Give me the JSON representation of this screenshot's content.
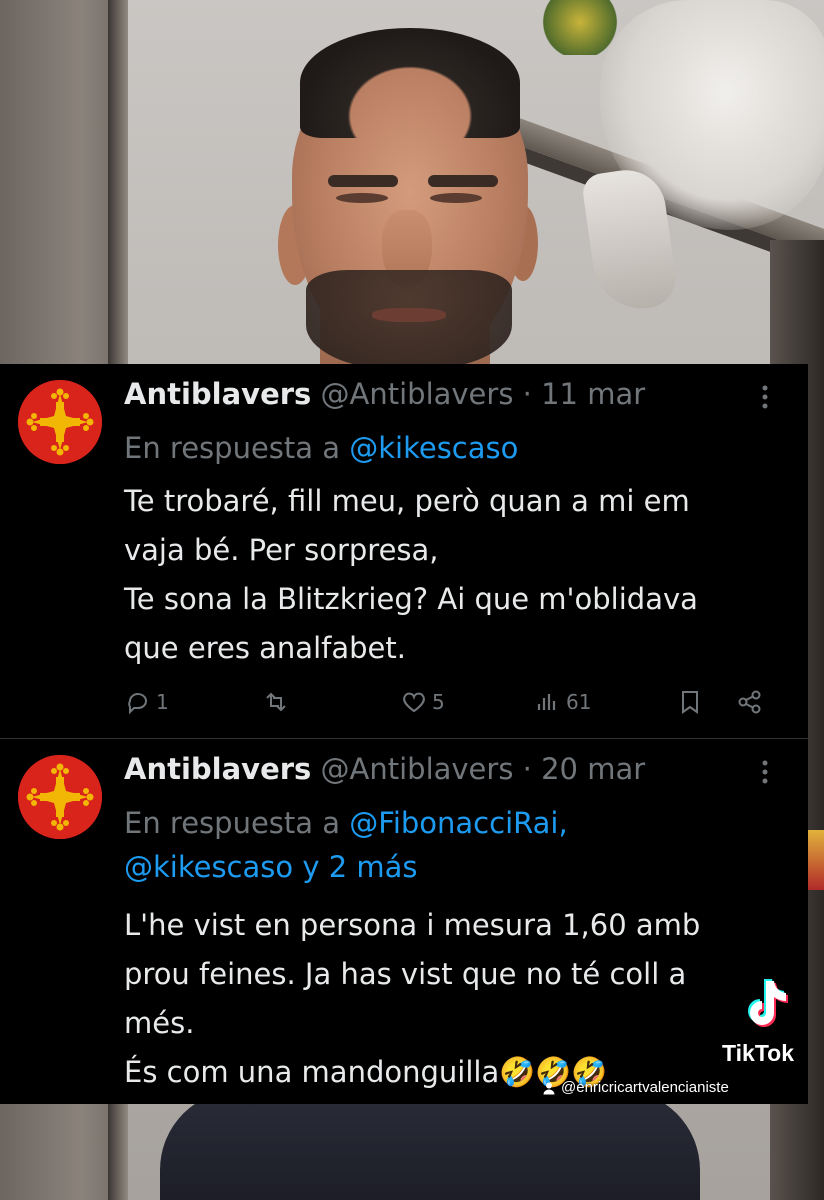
{
  "tweets": [
    {
      "display_name": "Antiblavers",
      "handle": "@Antiblavers",
      "separator": " · ",
      "date": "11 mar",
      "reply_prefix": "En respuesta a ",
      "reply_mentions": "@kikescaso",
      "body_lines": [
        "Te trobaré, fill meu, però quan a mi em",
        "vaja bé. Per sorpresa,",
        "Te sona la Blitzkrieg? Ai que m'oblidava",
        "que eres analfabet."
      ],
      "replies": "1",
      "likes": "5",
      "views": "61",
      "avatar_icon": "occitan-cross-icon"
    },
    {
      "display_name": "Antiblavers",
      "handle": "@Antiblavers",
      "separator": " · ",
      "date": "20 mar",
      "reply_prefix": "En respuesta a ",
      "reply_mentions_line1": "@FibonacciRai,",
      "reply_mentions_line2": "@kikescaso y 2 más",
      "body_lines": [
        "L'he vist en persona i mesura 1,60 amb",
        "prou feines. Ja has vist que no té coll a",
        "més.",
        "És com una mandonguilla"
      ],
      "body_emoji": "🤣🤣🤣",
      "avatar_icon": "occitan-cross-icon"
    }
  ],
  "watermark": {
    "brand": "TikTok",
    "handle": "@enricricartvalencianiste",
    "icon": "tiktok-logo-icon"
  },
  "colors": {
    "card_background": "#000000",
    "primary_text": "#e7e9ea",
    "secondary_text": "#71767b",
    "link": "#1d9bf0",
    "avatar_red": "#d9241c",
    "cross_gold": "#f2b705"
  }
}
